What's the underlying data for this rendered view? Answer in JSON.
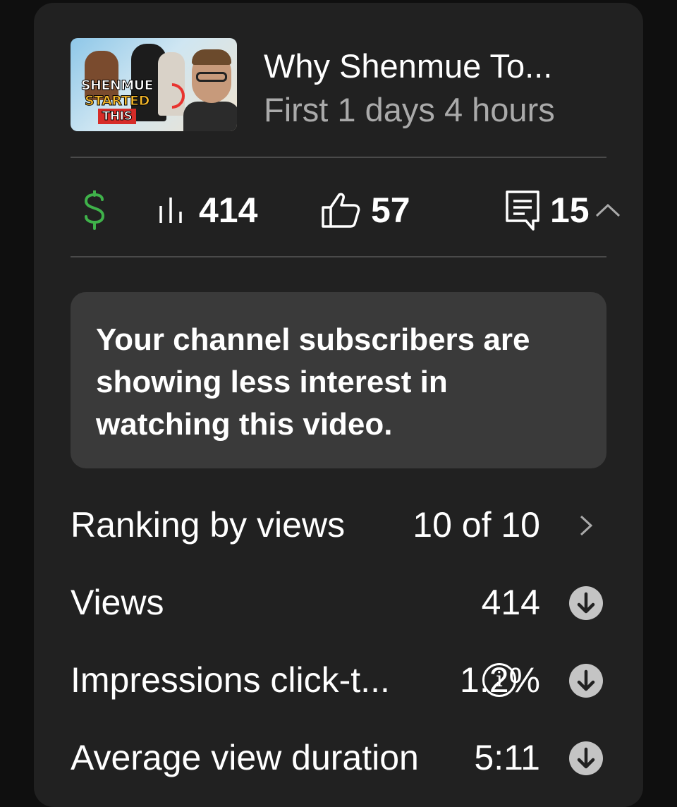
{
  "video": {
    "title": "Why Shenmue To...",
    "subtitle": "First 1 days 4 hours",
    "thumbnail_text": [
      "SHENMUE",
      "STARTED",
      "THIS"
    ]
  },
  "stats": {
    "monetization_icon": "dollar-icon",
    "views": "414",
    "likes": "57",
    "comments": "15"
  },
  "notice": {
    "text": "Your channel subscribers are showing less interest in watching this video."
  },
  "metrics": [
    {
      "label": "Ranking by views",
      "value": "10 of 10",
      "trailing": "chevron-right-icon"
    },
    {
      "label": "Views",
      "value": "414",
      "trailing": "arrow-down-circle-icon"
    },
    {
      "label": "Impressions click-t...",
      "value": "1.2%",
      "trailing": "arrow-down-circle-icon"
    },
    {
      "label": "Average view duration",
      "value": "5:11",
      "trailing": "arrow-down-circle-icon"
    }
  ],
  "colors": {
    "background": "#0f0f0f",
    "card": "#212121",
    "notice": "#3a3a3a",
    "money_green": "#3fb24a",
    "muted_text": "#aaaaaa"
  }
}
